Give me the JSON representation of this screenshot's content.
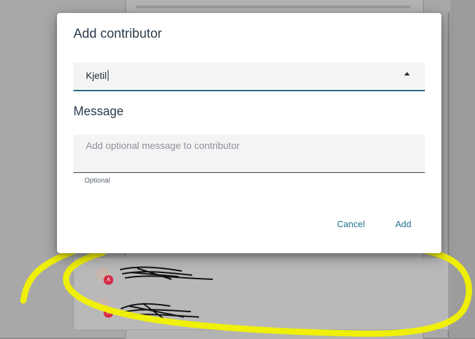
{
  "dialog": {
    "title": "Add contributor",
    "contributor_value": "Kjetil",
    "message_label": "Message",
    "message_placeholder": "Add optional message to contributor",
    "helper_text": "Optional",
    "cancel_label": "Cancel",
    "add_label": "Add"
  },
  "background": {
    "badge_text": "A"
  },
  "colors": {
    "accent": "#1c6e7d",
    "button_text": "#1f6f84",
    "title_text": "#2a3b4b",
    "overlay": "#8f8f8f",
    "highlight": "#f2f200",
    "badge": "#d62a44"
  },
  "icons": {
    "dropdown": "caret-up-icon"
  }
}
